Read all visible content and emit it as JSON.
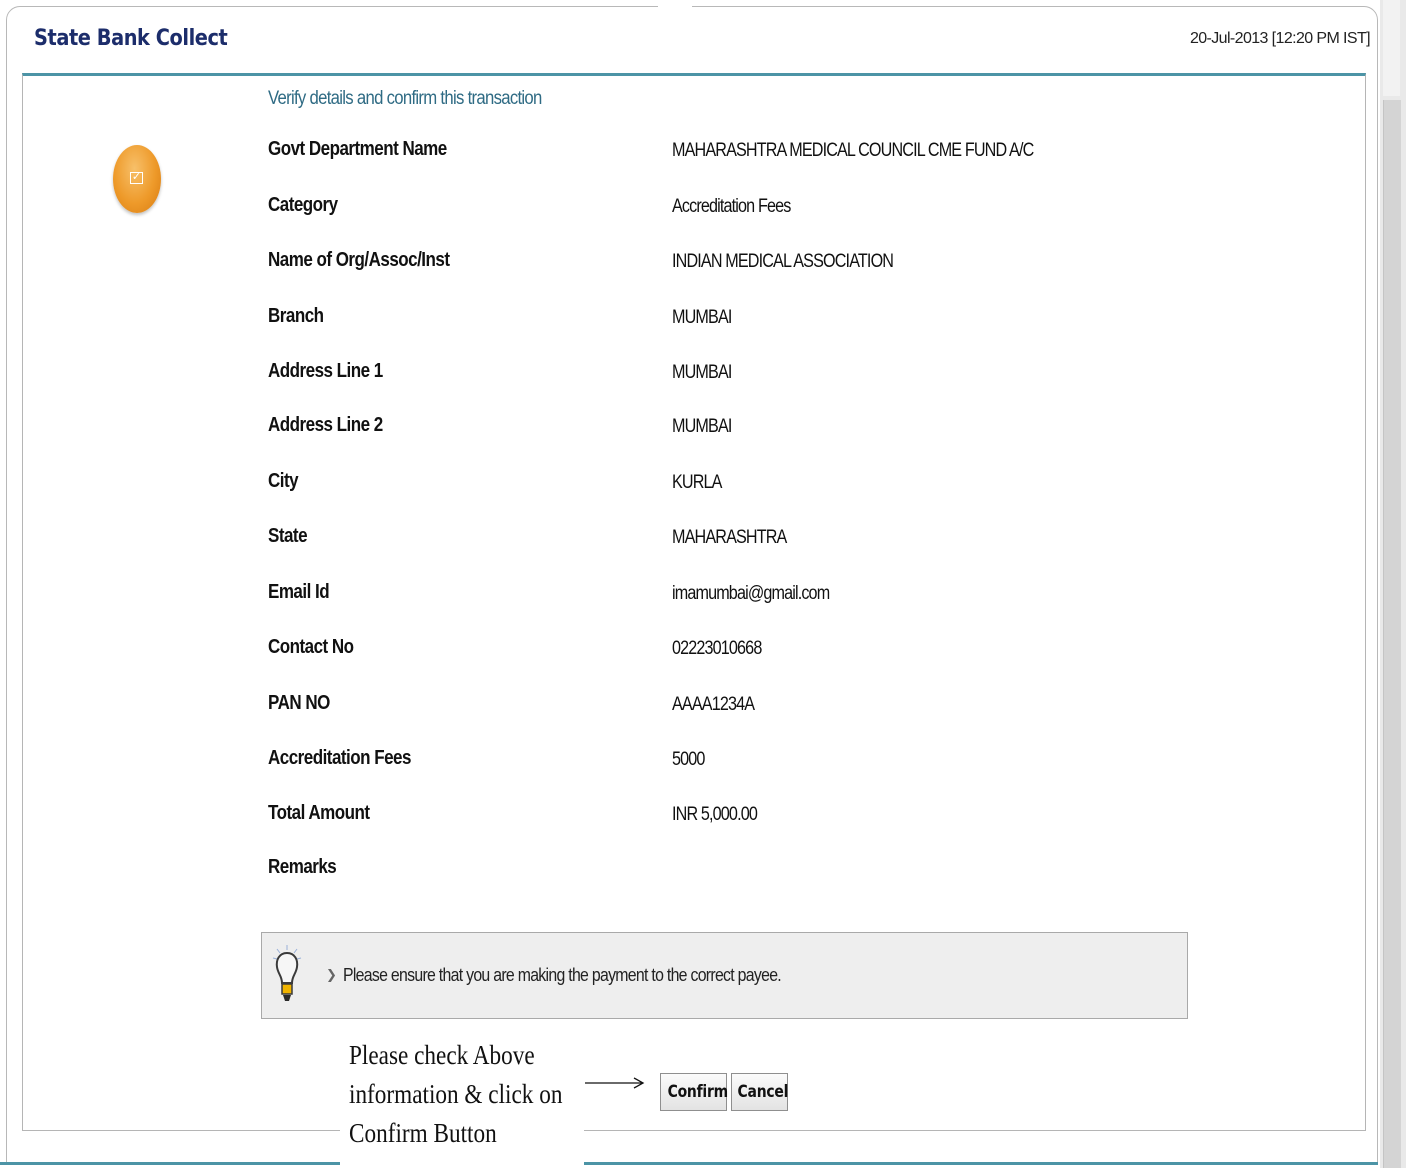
{
  "header": {
    "app_title": "State Bank Collect",
    "datetime": "20-Jul-2013 [12:20 PM IST]"
  },
  "main": {
    "heading": "Verify details and confirm this transaction",
    "icon": "confirm-check-icon",
    "details": [
      {
        "label": "Govt Department Name",
        "value": "MAHARASHTRA MEDICAL COUNCIL CME FUND A/C"
      },
      {
        "label": "Category",
        "value": "Accreditation Fees"
      },
      {
        "label": "Name of Org/Assoc/Inst",
        "value": "INDIAN MEDICAL ASSOCIATION"
      },
      {
        "label": "Branch",
        "value": "MUMBAI"
      },
      {
        "label": "Address Line 1",
        "value": "MUMBAI"
      },
      {
        "label": "Address Line 2",
        "value": "MUMBAI"
      },
      {
        "label": "City",
        "value": "KURLA"
      },
      {
        "label": "State",
        "value": "MAHARASHTRA"
      },
      {
        "label": "Email Id",
        "value": "imamumbai@gmail.com"
      },
      {
        "label": "Contact No",
        "value": "02223010668"
      },
      {
        "label": "PAN NO",
        "value": "AAAA1234A"
      },
      {
        "label": "Accreditation Fees",
        "value": "5000"
      },
      {
        "label": "Total Amount",
        "value": "INR 5,000.00"
      },
      {
        "label": "Remarks",
        "value": ""
      }
    ],
    "notice": {
      "icon": "lightbulb-icon",
      "text": "Please ensure that you are making the payment to the correct payee."
    },
    "instruction": {
      "lines": [
        "Please check Above",
        "information & click on",
        "Confirm Button"
      ]
    },
    "actions": {
      "confirm_label": "Confirm",
      "cancel_label": "Cancel"
    }
  },
  "colors": {
    "title": "#1c2d6b",
    "heading": "#2f6b84",
    "accent_rule": "#4c94a6",
    "icon_orange": "#ee9a2a"
  }
}
